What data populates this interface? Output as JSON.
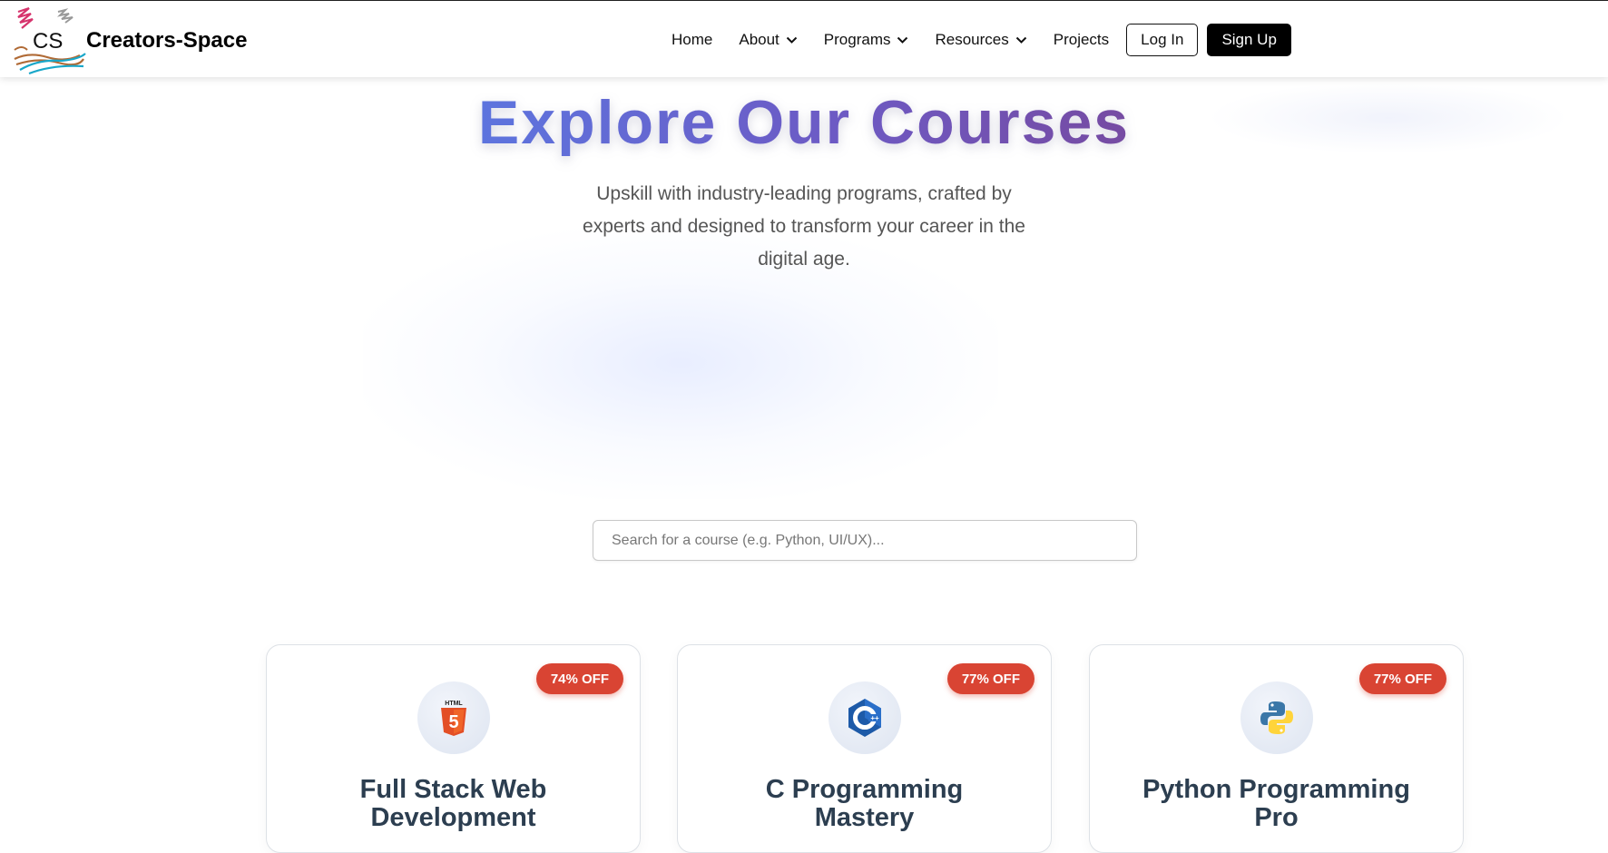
{
  "header": {
    "logo_text": "CS",
    "brand": "Creators-Space",
    "nav": [
      {
        "label": "Home",
        "dropdown": false
      },
      {
        "label": "About",
        "dropdown": true
      },
      {
        "label": "Programs",
        "dropdown": true
      },
      {
        "label": "Resources",
        "dropdown": true
      },
      {
        "label": "Projects",
        "dropdown": false
      }
    ],
    "login_label": "Log In",
    "signup_label": "Sign Up"
  },
  "hero": {
    "title": "Explore Our Courses",
    "subtitle": "Upskill with industry-leading programs, crafted by experts and designed to transform your career in the digital age."
  },
  "search": {
    "placeholder": "Search for a course (e.g. Python, UI/UX)...",
    "value": ""
  },
  "courses": [
    {
      "title": "Full Stack Web Development",
      "discount": "74% OFF",
      "icon": "html5-icon"
    },
    {
      "title": "C Programming Mastery",
      "discount": "77% OFF",
      "icon": "c-language-icon"
    },
    {
      "title": "Python Programming Pro",
      "discount": "77% OFF",
      "icon": "python-icon"
    }
  ],
  "colors": {
    "title_gradient_start": "#5d74de",
    "title_gradient_end": "#764ba2",
    "badge": "#d94433",
    "card_title": "#2c3e50",
    "signup_bg": "#000000"
  }
}
